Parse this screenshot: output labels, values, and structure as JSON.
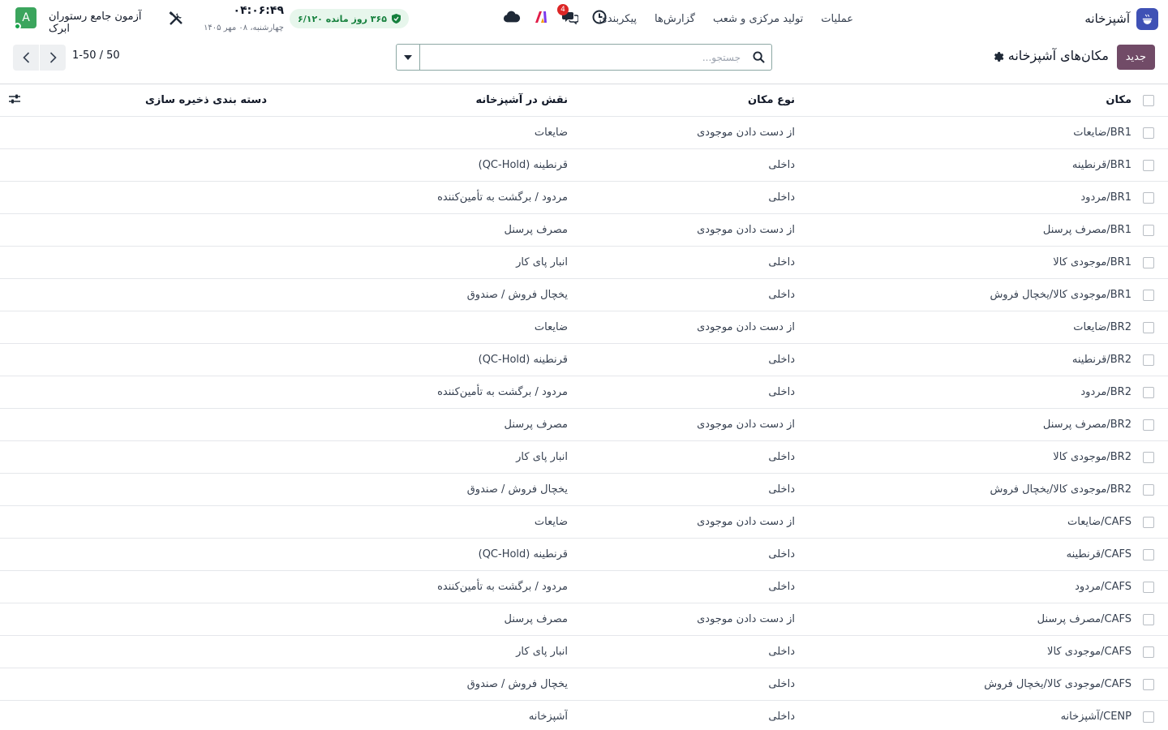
{
  "navbar": {
    "app_name": "آشپزخانه",
    "menu": [
      "عملیات",
      "تولید مرکزی و شعب",
      "گزارش‌ها",
      "پیکربندی"
    ],
    "chat_badge": "4",
    "license": "۳۶۵ روز مانده  ۶/۱۲۰",
    "clock_time": "۰۴:۰۶:۴۹",
    "clock_date": "چهارشنبه، ۰۸ مهر ۱۴۰۵",
    "company": "آزمون جامع رستوران ابرک",
    "avatar_letter": "A",
    "colors": {
      "app_icon": "#3f51b5",
      "avatar": "#3ba55d",
      "badge": "#dc2626",
      "license_bg": "#e7f6ec",
      "license_text": "#15803d"
    }
  },
  "control": {
    "new_label": "جدید",
    "title": "مکان‌های آشپزخانه",
    "search_placeholder": "جستجو...",
    "pager": "1-50 / 50",
    "colors": {
      "primary": "#714b67"
    }
  },
  "table": {
    "headers": {
      "location": "مکان",
      "type": "نوع مکان",
      "role": "نقش در آشپزخانه",
      "storage": "دسته بندی ذخیره سازی"
    },
    "rows": [
      {
        "location": "BR1/ضایعات",
        "type": "از دست دادن موجودی",
        "role": "ضایعات",
        "storage": ""
      },
      {
        "location": "BR1/قرنطینه",
        "type": "داخلی",
        "role": "قرنطینه (QC-Hold)",
        "storage": ""
      },
      {
        "location": "BR1/مردود",
        "type": "داخلی",
        "role": "مردود / برگشت به تأمین‌کننده",
        "storage": ""
      },
      {
        "location": "BR1/مصرف پرسنل",
        "type": "از دست دادن موجودی",
        "role": "مصرف پرسنل",
        "storage": ""
      },
      {
        "location": "BR1/موجودی کالا",
        "type": "داخلی",
        "role": "انبار پای کار",
        "storage": ""
      },
      {
        "location": "BR1/موجودی کالا/یخچال فروش",
        "type": "داخلی",
        "role": "یخچال فروش / صندوق",
        "storage": ""
      },
      {
        "location": "BR2/ضایعات",
        "type": "از دست دادن موجودی",
        "role": "ضایعات",
        "storage": ""
      },
      {
        "location": "BR2/قرنطینه",
        "type": "داخلی",
        "role": "قرنطینه (QC-Hold)",
        "storage": ""
      },
      {
        "location": "BR2/مردود",
        "type": "داخلی",
        "role": "مردود / برگشت به تأمین‌کننده",
        "storage": ""
      },
      {
        "location": "BR2/مصرف پرسنل",
        "type": "از دست دادن موجودی",
        "role": "مصرف پرسنل",
        "storage": ""
      },
      {
        "location": "BR2/موجودی کالا",
        "type": "داخلی",
        "role": "انبار پای کار",
        "storage": ""
      },
      {
        "location": "BR2/موجودی کالا/یخچال فروش",
        "type": "داخلی",
        "role": "یخچال فروش / صندوق",
        "storage": ""
      },
      {
        "location": "CAFS/ضایعات",
        "type": "از دست دادن موجودی",
        "role": "ضایعات",
        "storage": ""
      },
      {
        "location": "CAFS/قرنطینه",
        "type": "داخلی",
        "role": "قرنطینه (QC-Hold)",
        "storage": ""
      },
      {
        "location": "CAFS/مردود",
        "type": "داخلی",
        "role": "مردود / برگشت به تأمین‌کننده",
        "storage": ""
      },
      {
        "location": "CAFS/مصرف پرسنل",
        "type": "از دست دادن موجودی",
        "role": "مصرف پرسنل",
        "storage": ""
      },
      {
        "location": "CAFS/موجودی کالا",
        "type": "داخلی",
        "role": "انبار پای کار",
        "storage": ""
      },
      {
        "location": "CAFS/موجودی کالا/یخچال فروش",
        "type": "داخلی",
        "role": "یخچال فروش / صندوق",
        "storage": ""
      },
      {
        "location": "CENP/آشپزخانه",
        "type": "داخلی",
        "role": "آشپزخانه",
        "storage": ""
      }
    ]
  }
}
